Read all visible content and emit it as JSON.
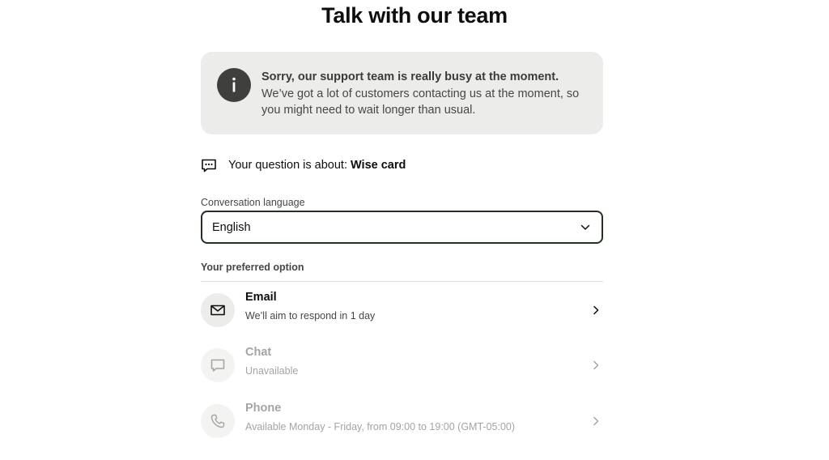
{
  "header": {
    "title": "Talk with our team"
  },
  "alert": {
    "icon": "info-icon",
    "title": "Sorry, our support team is really busy at the moment.",
    "body": "We’ve got a lot of customers contacting us at the moment, so you might need to wait longer than usual."
  },
  "topic": {
    "icon": "chat-bubble-icon",
    "prefix": "Your question is about:",
    "value": "Wise card"
  },
  "language": {
    "label": "Conversation language",
    "selected": "English"
  },
  "options": {
    "heading": "Your preferred option",
    "items": [
      {
        "icon": "mail-icon",
        "title": "Email",
        "subtitle": "We’ll aim to respond in 1 day",
        "available": true
      },
      {
        "icon": "chat-icon",
        "title": "Chat",
        "subtitle": "Unavailable",
        "available": false
      },
      {
        "icon": "phone-icon",
        "title": "Phone",
        "subtitle": "Available Monday - Friday, from 09:00 to 19:00 (GMT-05:00)",
        "available": false
      }
    ]
  },
  "colors": {
    "text": "#0e0f0c",
    "muted": "#454745",
    "disabled": "#a3a5a2",
    "alert_bg": "#ecedea",
    "select_border": "#233022"
  }
}
